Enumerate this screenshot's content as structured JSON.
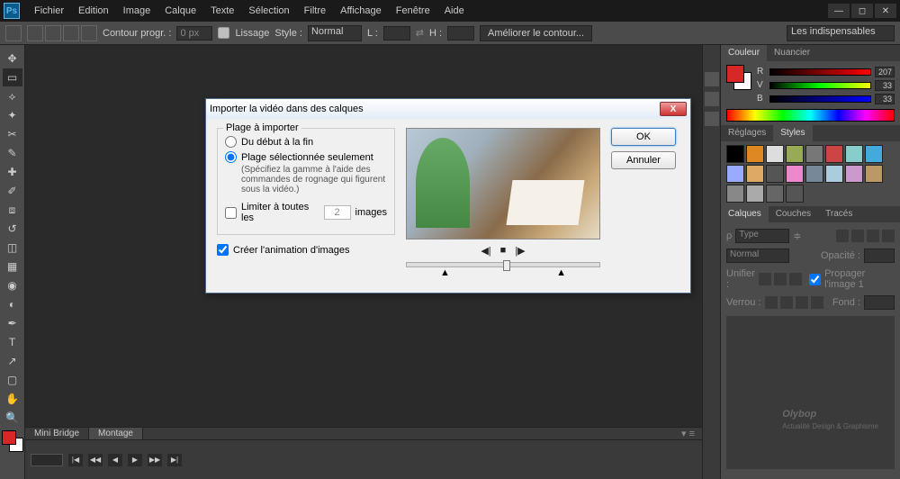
{
  "app": {
    "logo": "Ps"
  },
  "menu": [
    "Fichier",
    "Edition",
    "Image",
    "Calque",
    "Texte",
    "Sélection",
    "Filtre",
    "Affichage",
    "Fenêtre",
    "Aide"
  ],
  "options_bar": {
    "label_contour": "Contour progr. :",
    "contour_val": "0 px",
    "lissage": "Lissage",
    "style_label": "Style :",
    "style_val": "Normal",
    "l_label": "L :",
    "h_label": "H :",
    "refine": "Améliorer le contour...",
    "preset_right": "Les indispensables"
  },
  "bottom_tabs": {
    "mini": "Mini Bridge",
    "montage": "Montage"
  },
  "panels": {
    "color": {
      "tab1": "Couleur",
      "tab2": "Nuancier",
      "sliders": [
        {
          "lab": "R",
          "val": "207",
          "grad": "grad-r"
        },
        {
          "lab": "V",
          "val": "33",
          "grad": "grad-v"
        },
        {
          "lab": "B",
          "val": "33",
          "grad": "grad-b"
        }
      ]
    },
    "styles": {
      "tab1": "Réglages",
      "tab2": "Styles",
      "colors": [
        "#000",
        "#d82",
        "#ddd",
        "#9a5",
        "#777",
        "#c44",
        "#8cc",
        "#4ad",
        "#9af",
        "#da6",
        "#555",
        "#e8c",
        "#789",
        "#acd",
        "#c9c",
        "#b96",
        "#888",
        "#aaa",
        "#666",
        "#555"
      ]
    },
    "layers": {
      "tab1": "Calques",
      "tab2": "Couches",
      "tab3": "Tracés",
      "kind": "Type",
      "blend": "Normal",
      "opacity_lbl": "Opacité :",
      "unify": "Unifier :",
      "propagate": "Propager l'image 1",
      "lock_lbl": "Verrou :",
      "fill_lbl": "Fond :"
    }
  },
  "dialog": {
    "title": "Importer la vidéo dans des calques",
    "legend": "Plage à importer",
    "radio1": "Du début à la fin",
    "radio2": "Plage sélectionnée seulement",
    "note": "(Spécifiez la gamme à l'aide des commandes de rognage qui figurent sous la vidéo.)",
    "limit_label": "Limiter à toutes les",
    "limit_val": "2",
    "limit_suffix": "images",
    "checkbox": "Créer l'animation d'images",
    "ok": "OK",
    "cancel": "Annuler"
  },
  "watermark": {
    "brand": "Olybop",
    "tagline": "Actualité Design & Graphisme"
  }
}
